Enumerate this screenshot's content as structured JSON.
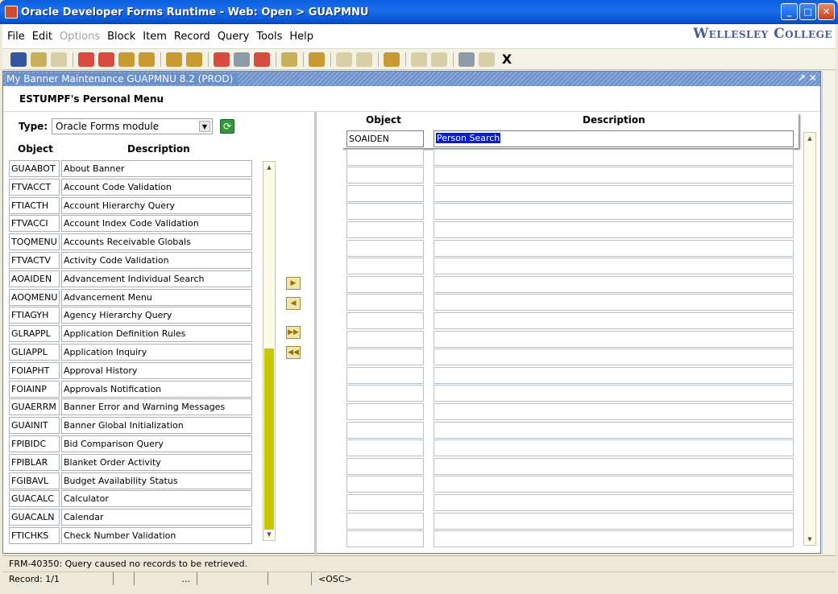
{
  "window": {
    "title": "Oracle Developer Forms Runtime - Web:  Open > GUAPMNU",
    "min": "_",
    "max": "□",
    "close": "✕"
  },
  "menubar": {
    "items": [
      "File",
      "Edit",
      "Options",
      "Block",
      "Item",
      "Record",
      "Query",
      "Tools",
      "Help"
    ],
    "brand": "Wellesley College"
  },
  "toolbar": {
    "exit_label": "X"
  },
  "inner_window": {
    "title": "My Banner Maintenance  GUAPMNU  8.2  (PROD)",
    "controls": "↗ ✕",
    "menu_title": "ESTUMPF's Personal Menu"
  },
  "left": {
    "type_label": "Type:",
    "type_value": "Oracle Forms module",
    "col_object": "Object",
    "col_description": "Description",
    "rows": [
      {
        "obj": "GUAABOT",
        "desc": "About Banner"
      },
      {
        "obj": "FTVACCT",
        "desc": "Account Code Validation"
      },
      {
        "obj": "FTIACTH",
        "desc": "Account Hierarchy Query"
      },
      {
        "obj": "FTVACCI",
        "desc": "Account Index Code Validation"
      },
      {
        "obj": "TOQMENU",
        "desc": "Accounts Receivable Globals"
      },
      {
        "obj": "FTVACTV",
        "desc": "Activity Code Validation"
      },
      {
        "obj": "AOAIDEN",
        "desc": "Advancement Individual Search"
      },
      {
        "obj": "AOQMENU",
        "desc": "Advancement Menu"
      },
      {
        "obj": "FTIAGYH",
        "desc": "Agency Hierarchy Query"
      },
      {
        "obj": "GLRAPPL",
        "desc": "Application Definition Rules"
      },
      {
        "obj": "GLIAPPL",
        "desc": "Application Inquiry"
      },
      {
        "obj": "FOIAPHT",
        "desc": "Approval History"
      },
      {
        "obj": "FOIAINP",
        "desc": "Approvals Notification"
      },
      {
        "obj": "GUAERRM",
        "desc": "Banner Error and Warning Messages"
      },
      {
        "obj": "GUAINIT",
        "desc": "Banner Global Initialization"
      },
      {
        "obj": "FPIBIDC",
        "desc": "Bid Comparison Query"
      },
      {
        "obj": "FPIBLAR",
        "desc": "Blanket Order Activity"
      },
      {
        "obj": "FGIBAVL",
        "desc": "Budget Availability Status"
      },
      {
        "obj": "GUACALC",
        "desc": "Calculator"
      },
      {
        "obj": "GUACALN",
        "desc": "Calendar"
      },
      {
        "obj": "FTICHKS",
        "desc": "Check Number Validation"
      }
    ]
  },
  "right": {
    "col_object": "Object",
    "col_description": "Description",
    "first_row": {
      "obj": "SOAIDEN",
      "desc": "Person Search"
    }
  },
  "status": {
    "message": "FRM-40350: Query caused no records to be retrieved.",
    "record": "Record: 1/1",
    "cell3": "...",
    "osc": "<OSC>"
  }
}
